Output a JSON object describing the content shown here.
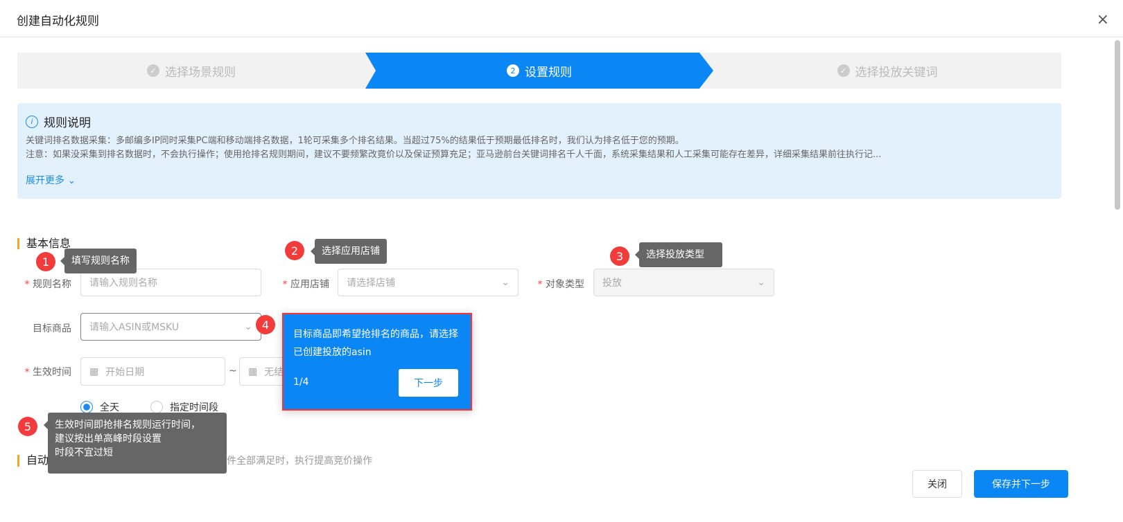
{
  "dialog": {
    "title": "创建自动化规则",
    "close_icon": "×"
  },
  "steps": [
    {
      "label": "选择场景规则",
      "mark": "✓"
    },
    {
      "label": "设置规则",
      "mark": "2"
    },
    {
      "label": "选择投放关键词",
      "mark": "✓"
    }
  ],
  "info": {
    "title": "规则说明",
    "line1": "关键词排名数据采集：多邮编多IP同时采集PC端和移动端排名数据，1轮可采集多个排名结果。当超过75%的结果低于预期最低排名时，我们认为排名低于您的预期。",
    "line2": "注意：如果没采集到排名数据时，不会执行操作；使用抢排名规则期间，建议不要频繁改竟价以及保证预算充足；亚马逊前台关键词排名千人千面，系统采集结果和人工采集可能存在差异，详细采集结果前往执行记...",
    "expand": "展开更多"
  },
  "basic": {
    "title": "基本信息",
    "rule_name": {
      "label": "规则名称",
      "placeholder": "请输入规则名称"
    },
    "store": {
      "label": "应用店铺",
      "placeholder": "请选择店铺"
    },
    "object_type": {
      "label": "对象类型",
      "value": "投放"
    },
    "target": {
      "label": "目标商品",
      "placeholder": "请输入ASIN或MSKU"
    },
    "effective": {
      "label": "生效时间",
      "start": "开始日期",
      "sep": "~",
      "end": "无结束日期"
    },
    "radio_all": "全天",
    "radio_range": "指定时间段"
  },
  "auto": {
    "title": "自动加价",
    "desc": "当排名低于期望位置且广告数据条件全部满足时，执行提高竞价操作"
  },
  "guides": [
    {
      "n": "1",
      "text": "填写规则名称"
    },
    {
      "n": "2",
      "text": "选择应用店铺"
    },
    {
      "n": "3",
      "text": "选择投放类型"
    },
    {
      "n": "4",
      "text": "目标商品即希望抢排名的商品，请选择已创建投放的asin",
      "count": "1/4",
      "next": "下一步"
    },
    {
      "n": "5",
      "l1": "生效时间即抢排名规则运行时间，",
      "l2": "建议按出单高峰时段设置",
      "l3": "时段不宜过短"
    }
  ],
  "footer": {
    "close": "关闭",
    "save": "保存并下一步"
  }
}
